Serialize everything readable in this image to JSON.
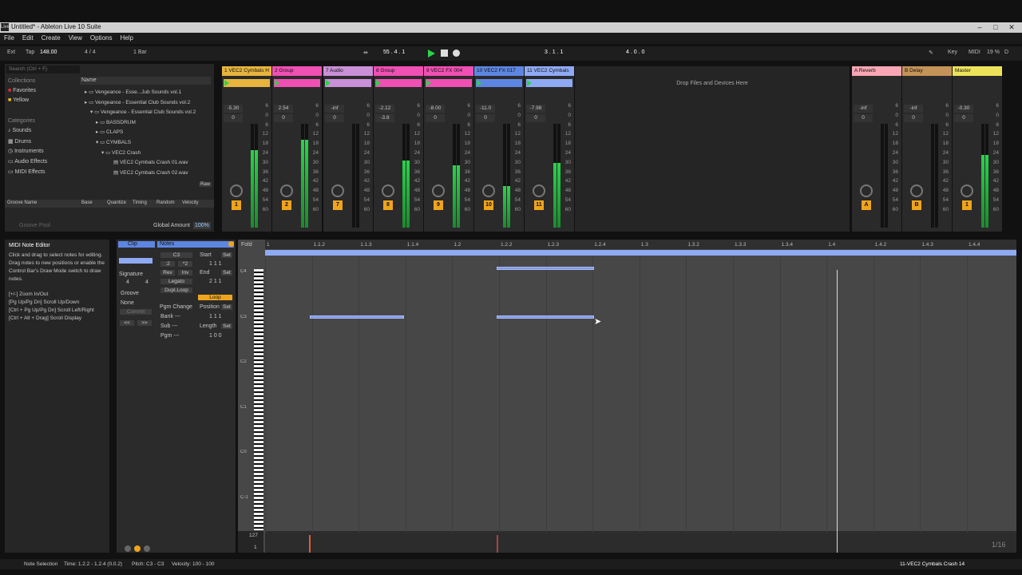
{
  "window": {
    "title": "Untitled* - Ableton Live 10 Suite",
    "app_icon": "Live"
  },
  "menu": [
    "File",
    "Edit",
    "Create",
    "View",
    "Options",
    "Help"
  ],
  "transport": {
    "ext": "Ext",
    "tap": "Tap",
    "tempo": "148.00",
    "signature": "4 / 4",
    "quantize": "1 Bar",
    "position": "55 . 4 . 1",
    "loop_start": "3 . 1 . 1",
    "loop_length": "4 . 0 . 0",
    "key": "Key",
    "midi": "MIDI",
    "cpu": "19 %",
    "d": "D"
  },
  "browser": {
    "search_placeholder": "Search (Ctrl + F)",
    "collections_label": "Collections",
    "collections": [
      "Favorites",
      "Yellow"
    ],
    "categories_label": "Categories",
    "categories": [
      "Sounds",
      "Drums",
      "Instruments",
      "Audio Effects",
      "MIDI Effects"
    ],
    "name_header": "Name",
    "files": [
      "Vengeance - Esse...Jub Sounds vol.1",
      "Vengeance - Essential Club Sounds vol.2",
      "Vengeance - Essential Club Sounds vol.2",
      "BASSDRUM",
      "CLAPS",
      "CYMBALS",
      "VEC2 Crash",
      "VEC2 Cymbals Crash 01.wav",
      "VEC2 Cymbals Crash 02.wav"
    ],
    "raw": "Raw",
    "groove_headers": [
      "Groove Name",
      "Base",
      "Quantize",
      "Timing",
      "Random",
      "Velocity"
    ],
    "groove_pool": "Groove Pool",
    "global_amount_label": "Global Amount",
    "global_amount": "100%"
  },
  "tracks": [
    {
      "name": "1 VEC2 Cymbals H",
      "color": "#e7b43d",
      "vol": "-5.30",
      "pan": "0",
      "num": "1",
      "meter": 0.75
    },
    {
      "name": "2 Group",
      "color": "#f04fb4",
      "vol": "2.54",
      "pan": "0",
      "num": "2",
      "meter": 0.85
    },
    {
      "name": "7 Audio",
      "color": "#c990d8",
      "vol": "-inf",
      "pan": "0",
      "num": "7",
      "meter": 0
    },
    {
      "name": "8 Group",
      "color": "#f04fb4",
      "vol": "-2.12",
      "pan": "-3.8",
      "num": "8",
      "meter": 0.65
    },
    {
      "name": "9 VEC2 FX 004",
      "color": "#f04fb4",
      "vol": "-8.00",
      "pan": "0",
      "num": "9",
      "meter": 0.6
    },
    {
      "name": "10 VEC2 FX 017",
      "color": "#5d86e2",
      "vol": "-11.0",
      "pan": "0",
      "num": "10",
      "meter": 0.4
    },
    {
      "name": "11 VEC2 Cymbals",
      "color": "#8faaf5",
      "vol": "-7.98",
      "pan": "0",
      "num": "11",
      "meter": 0.62
    }
  ],
  "returns": [
    {
      "name": "A Reverb",
      "color": "#f8a6b5",
      "vol": "-inf",
      "pan": "0",
      "num": "A"
    },
    {
      "name": "B Delay",
      "color": "#c49358",
      "vol": "-inf",
      "pan": "0",
      "num": "B"
    },
    {
      "name": "Master",
      "color": "#ede35a",
      "vol": "-0.30",
      "pan": "0",
      "num": "1"
    }
  ],
  "drop_zone": "Drop Files and Devices Here",
  "db_scale": [
    "6",
    "0",
    "6",
    "12",
    "18",
    "24",
    "30",
    "36",
    "42",
    "48",
    "54",
    "60"
  ],
  "info": {
    "title": "MIDI Note Editor",
    "body": "Click and drag to select notes for editing. Drag notes to new positions or enable the Control Bar's Draw Mode switch to draw notes.",
    "shortcuts": [
      "[+/-] Zoom In/Out",
      "[Pg Up/Pg Dn] Scroll Up/Down",
      "[Ctrl + Pg Up/Pg Dn] Scroll Left/Right",
      "[Ctrl + Alt + Drag] Scroll Display"
    ]
  },
  "clip": {
    "clip_tab": "Clip",
    "notes_tab": "Notes",
    "signature_label": "Signature",
    "sig_num": "4",
    "sig_den": "4",
    "groove_label": "Groove",
    "groove_value": "None",
    "commit": "Commit",
    "note": "C3",
    "start_label": "Start",
    "set": "Set",
    "start": "1   1   1",
    "end_label": "End",
    "end": "2   1   1",
    "rev": "Rev",
    "inv": "Inv",
    "legato": "Legato",
    "dupl_loop": "Dupl.Loop",
    "loop": "Loop",
    "pgm_change": "Pgm Change",
    "position_label": "Position",
    "position": "1   1   1",
    "bank": "Bank ---",
    "sub": "Sub ---",
    "pgm": "Pgm ---",
    "length_label": "Length",
    "length": "1   0   0",
    "half": ":2",
    "double": "*2"
  },
  "editor": {
    "fold": "Fold",
    "bars": [
      "1",
      "1.1.2",
      "1.1.3",
      "1.1.4",
      "1.2",
      "1.2.2",
      "1.2.3",
      "1.2.4",
      "1.3",
      "1.3.2",
      "1.3.3",
      "1.3.4",
      "1.4",
      "1.4.2",
      "1.4.3",
      "1.4.4"
    ],
    "octaves": [
      "C4",
      "C3",
      "C2",
      "C1",
      "C0",
      "C-1"
    ],
    "vel_top": "127",
    "vel_bottom": "1",
    "grid": "1/16"
  },
  "status": {
    "selection": "Note Selection",
    "time": "Time: 1.2.2 - 1.2.4 (0.0.2)",
    "pitch": "Pitch: C3 - C3",
    "velocity": "Velocity: 100 - 100",
    "track": "11-VEC2 Cymbals Crash 14"
  }
}
